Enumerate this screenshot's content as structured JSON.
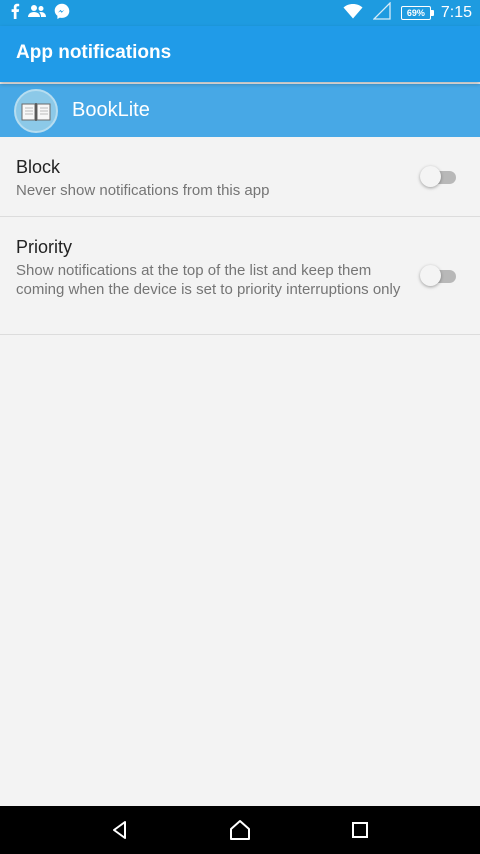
{
  "status_bar": {
    "left_icons": [
      "facebook-icon",
      "contacts-icon",
      "messenger-icon"
    ],
    "right_icons": [
      "wifi-icon",
      "signal-icon",
      "battery-icon"
    ],
    "battery": "69%",
    "clock": "7:15"
  },
  "app_bar": {
    "title": "App notifications"
  },
  "app_header": {
    "icon": "book-icon",
    "name": "BookLite"
  },
  "settings": [
    {
      "title": "Block",
      "subtitle": "Never show notifications from this app",
      "enabled": false
    },
    {
      "title": "Priority",
      "subtitle": "Show notifications at the top of the list and keep them coming when the device is set to priority interruptions only",
      "enabled": false
    }
  ],
  "nav_bar": {
    "buttons": [
      "back-icon",
      "home-icon",
      "recents-icon"
    ]
  },
  "colors": {
    "status_bar": "#1E9BE0",
    "app_bar": "#209BE8",
    "app_header": "#47A8E6",
    "background": "#F3F3F3"
  }
}
